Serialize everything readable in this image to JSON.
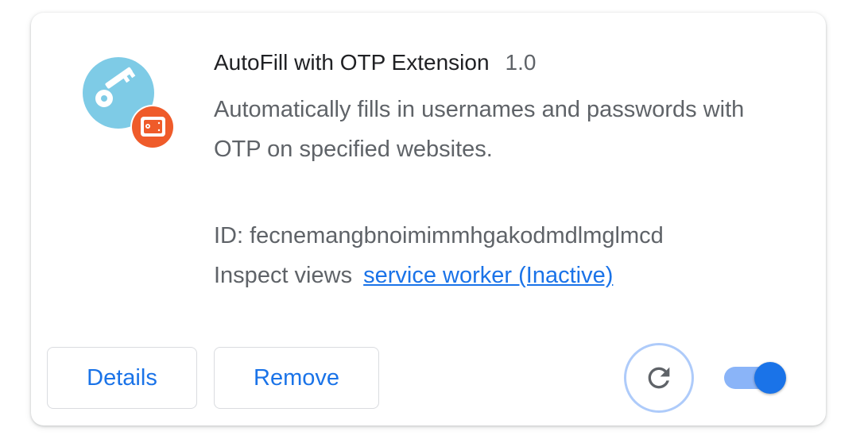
{
  "extension": {
    "name": "AutoFill with OTP Extension",
    "version": "1.0",
    "description": "Automatically fills in usernames and passwords with OTP on specified websites.",
    "id_label": "ID:",
    "id_value": "fecnemangbnoimimmhgakodmdlmglmcd",
    "inspect_label": "Inspect views",
    "inspect_link": "service worker (Inactive)",
    "enabled": true
  },
  "actions": {
    "details_label": "Details",
    "remove_label": "Remove"
  },
  "icons": {
    "extension": "key-icon",
    "badge": "drive-badge-icon",
    "reload": "reload-icon"
  },
  "colors": {
    "accent": "#1a73e8",
    "toggle_track": "#8ab4f8",
    "icon_circle": "#7ecbe6",
    "badge": "#ef5b2a"
  }
}
